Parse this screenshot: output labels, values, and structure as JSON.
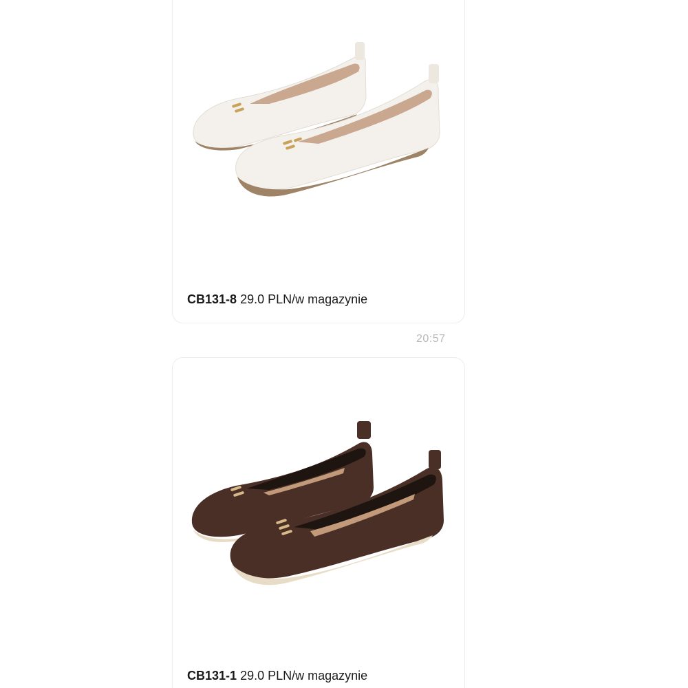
{
  "messages": [
    {
      "product_code": "CB131-8",
      "details": "29.0 PLN/w magazynie",
      "image_subject": "white-ballet-flats",
      "colors": {
        "shoe": "#f4f1ec",
        "lining": "#c9a88f",
        "sole": "#9e8366",
        "accent": "#c8a25a"
      }
    },
    {
      "product_code": "CB131-1",
      "details": "29.0 PLN/w magazynie",
      "image_subject": "brown-ballet-flats",
      "colors": {
        "shoe": "#4a2f27",
        "lining": "#c29a7a",
        "sole": "#e8dcc6",
        "accent": "#d8b98a"
      }
    }
  ],
  "timestamp": "20:57"
}
